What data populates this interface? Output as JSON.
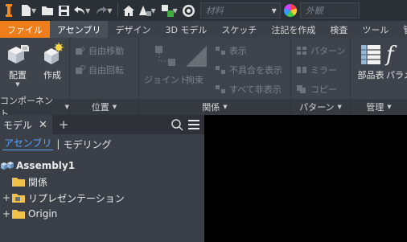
{
  "toolbar": {
    "material_placeholder": "材料",
    "appearance_placeholder": "外観"
  },
  "tabs": [
    {
      "label": "ファイル"
    },
    {
      "label": "アセンブリ"
    },
    {
      "label": "デザイン"
    },
    {
      "label": "3D モデル"
    },
    {
      "label": "スケッチ"
    },
    {
      "label": "注記を作成"
    },
    {
      "label": "検査"
    },
    {
      "label": "ツール"
    },
    {
      "label": "管理"
    }
  ],
  "ribbon": {
    "component": {
      "footer": "コンポーネント",
      "place": "配置",
      "create": "作成"
    },
    "position": {
      "footer": "位置",
      "free_move": "自由移動",
      "free_rotate": "自由回転"
    },
    "relationships": {
      "footer": "関係",
      "joint": "ジョイント",
      "constrain": "拘束",
      "show": "表示",
      "show_sick": "不具合を表示",
      "hide_all": "すべて非表示"
    },
    "pattern": {
      "footer": "パターン",
      "pattern": "パターン",
      "mirror": "ミラー",
      "copy": "コピー"
    },
    "manage": {
      "footer": "管理",
      "bom": "部品表",
      "params": "パラメ"
    }
  },
  "browser": {
    "tab_label": "モデル",
    "subtab_assembly": "アセンブリ",
    "subtab_modeling": "モデリング",
    "tree": [
      {
        "label": "Assembly1"
      },
      {
        "label": "関係"
      },
      {
        "label": "リプレゼンテーション"
      },
      {
        "label": "Origin"
      }
    ]
  },
  "colors": {
    "file_tab": "#ee7d1a",
    "accent_blue": "#56a6ff",
    "graphics_bg": "#000000"
  }
}
